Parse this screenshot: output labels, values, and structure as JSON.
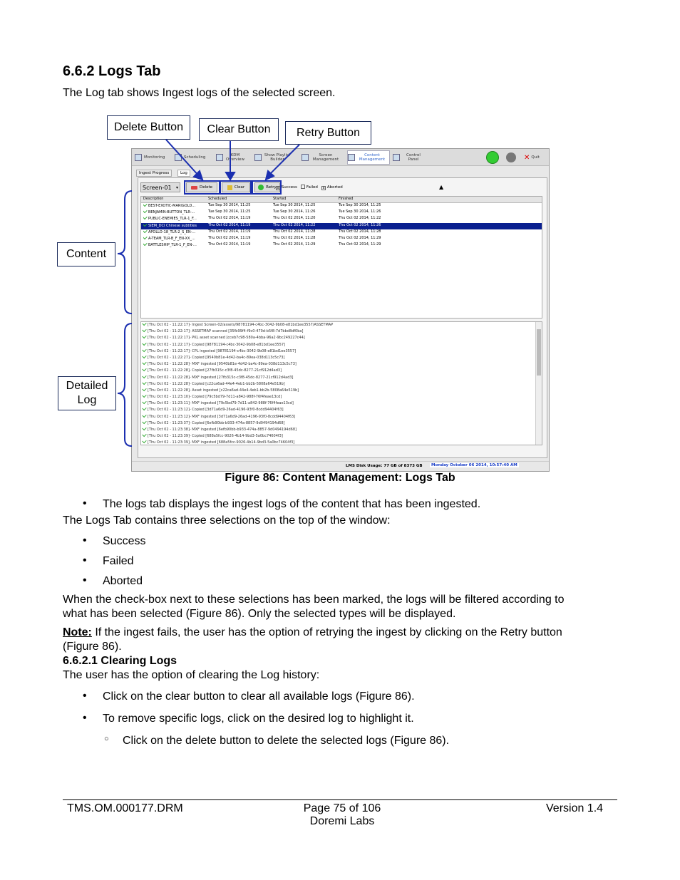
{
  "section": {
    "heading": "6.6.2  Logs Tab",
    "intro": "The Log tab shows Ingest logs of the selected screen."
  },
  "callouts": {
    "delete": "Delete Button",
    "clear": "Clear Button",
    "retry": "Retry Button",
    "content": "Content",
    "detailed_1": "Detailed",
    "detailed_2": "Log"
  },
  "screenshot": {
    "tabs": [
      "Monitoring",
      "Scheduling",
      "KDM Overview",
      "Show Playlist Builder",
      "Screen Management",
      "Content Management",
      "Control Panel"
    ],
    "quit": "Quit",
    "subtabs": [
      "Ingest Progress",
      "Log"
    ],
    "screen_select": "Screen-01",
    "buttons": {
      "delete": "Delete",
      "clear": "Clear",
      "retry": "Retry"
    },
    "filters": [
      "Success",
      "Failed",
      "Aborted"
    ],
    "columns": [
      "Description",
      "Scheduled",
      "Started",
      "Finished"
    ],
    "rows": [
      [
        "BEST-EXOTIC-MARIGOLD...",
        "Tue Sep 30 2014,  11:25",
        "Tue Sep 30 2014,  11:25",
        "Tue Sep 30 2014,  11:25"
      ],
      [
        "BENJAMIN-BUTTON_TLR-...",
        "Tue Sep 30 2014,  11:25",
        "Tue Sep 30 2014,  11:26",
        "Tue Sep 30 2014,  11:26"
      ],
      [
        "PUBLIC-ENEMIES_TLR-1_F...",
        "Thu Oct 02 2014,  11:19",
        "Thu Oct 02 2014,  11:20",
        "Thu Oct 02 2014,  11:22"
      ],
      [
        "SIEM_DCI Chinese subtitles",
        "Thu Oct 02 2014,  11:19",
        "Thu Oct 02 2014,  11:22",
        "Thu Oct 02 2014,  11:26"
      ],
      [
        "APOLLO-18_TLR-2_S_EN-...",
        "Thu Oct 02 2014,  11:19",
        "Thu Oct 02 2014,  11:28",
        "Thu Oct 02 2014,  11:28"
      ],
      [
        "A-TEAM_TLR-B_F_EN-XX_...",
        "Thu Oct 02 2014,  11:19",
        "Thu Oct 02 2014,  11:28",
        "Thu Oct 02 2014,  11:29"
      ],
      [
        "BATTLESHIP_TLR-1_F_EN-...",
        "Thu Oct 02 2014,  11:19",
        "Thu Oct 02 2014,  11:29",
        "Thu Oct 02 2014,  11:29"
      ]
    ],
    "logs": [
      "[Thu Oct 02 - 11:22:17]- Ingest Screen-02/assets/98781194-c4bc-3042-9b08-e81bd1ee3557/ASSETMAP",
      "[Thu Oct 02 - 11:22:17]- ASSETMAP scanned [35fb99f4-f9c0-470d-b5f8-7d7bbd8df0ba]",
      "[Thu Oct 02 - 11:22:17]- PKL asset scanned [cceb7c98-580a-4bba-96a2-9bc249227c44]",
      "[Thu Oct 02 - 11:22:17]- Copied [98781194-c4bc-3042-9b08-e81bd1ee3557]",
      "[Thu Oct 02 - 11:22:17]- CPL ingested [98781194-c4bc-3042-9b08-e81bd1ee3557]",
      "[Thu Oct 02 - 11:22:27]- Copied [9540b81e-4d42-ba4c-89ea-038d113c5c73]",
      "[Thu Oct 02 - 11:22:28]- MXF ingested [9540b81e-4d42-ba4c-89ea-038d113c5c73]",
      "[Thu Oct 02 - 11:22:28]- Copied [27fb315c-c3f8-45dc-8277-21cf912d4ad3]",
      "[Thu Oct 02 - 11:22:28]- MXF ingested [27fb315c-c3f8-45dc-8277-21cf912d4ad3]",
      "[Thu Oct 02 - 11:22:28]- Copied [c22ca6ad-44e4-4eb1-bb2b-5808a64e519b]",
      "[Thu Oct 02 - 11:22:28]- Asset ingested [c22ca6ad-44e4-4eb1-bb2b-5808a64e519b]",
      "[Thu Oct 02 - 11:23:10]- Copied [79c5bd79-7d11-a842-988f-76f4feae13cd]",
      "[Thu Oct 02 - 11:23:11]- MXF ingested [79c5bd79-7d11-a842-988f-76f4feae13cd]",
      "[Thu Oct 02 - 11:23:12]- Copied [3d71a6d9-26ad-4196-93f0-8cdd94404f63]",
      "[Thu Oct 02 - 11:23:12]- MXF ingested [3d71a6d9-26ad-4196-93f0-8cdd94404f63]",
      "[Thu Oct 02 - 11:23:37]- Copied [6efb90bb-b933-474a-8857-9d0494194d68]",
      "[Thu Oct 02 - 11:23:38]- MXF ingested [6efb90bb-b933-474a-8857-9d0494194d68]",
      "[Thu Oct 02 - 11:23:39]- Copied [688a5fcc-9026-4b14-9bd3-5a0bc74604f3]",
      "[Thu Oct 02 - 11:23:39]- MXF ingested [688a5fcc-9026-4b14-9bd3-5a0bc74604f3]"
    ],
    "disk_usage": "LMS Disk Usage: 77 GB of 8373 GB",
    "datetime": "Monday October 06 2014, 10:57:40 AM"
  },
  "caption": "Figure 86: Content Management: Logs Tab",
  "body": {
    "bullet1": "The logs tab displays the ingest logs of the content that has been ingested.",
    "para1": "The Logs Tab contains three selections on the top of the window:",
    "selections": [
      "Success",
      "Failed",
      "Aborted"
    ],
    "para2_line1": "When the check-box next to these selections has been marked, the logs will be filtered according to",
    "para2_line2": "what has been selected (Figure 86). Only the selected types will be displayed.",
    "note_label": "Note:",
    "note_line1": " If the ingest fails, the user has the option of retrying the ingest by clicking on the Retry button",
    "note_line2": "(Figure 86).",
    "subheading": "6.6.2.1 Clearing Logs",
    "para3": "The user has the option of clearing the Log history:",
    "bullet_clear": "Click on the clear button to clear all available logs (Figure 86).",
    "bullet_remove": "To remove specific logs, click on the desired log to highlight it.",
    "sub_bullet": "Click on the delete button to delete the selected logs (Figure 86)."
  },
  "footer": {
    "left": "TMS.OM.000177.DRM",
    "center1": "Page 75 of 106",
    "center2": "Doremi Labs",
    "right": "Version 1.4"
  }
}
